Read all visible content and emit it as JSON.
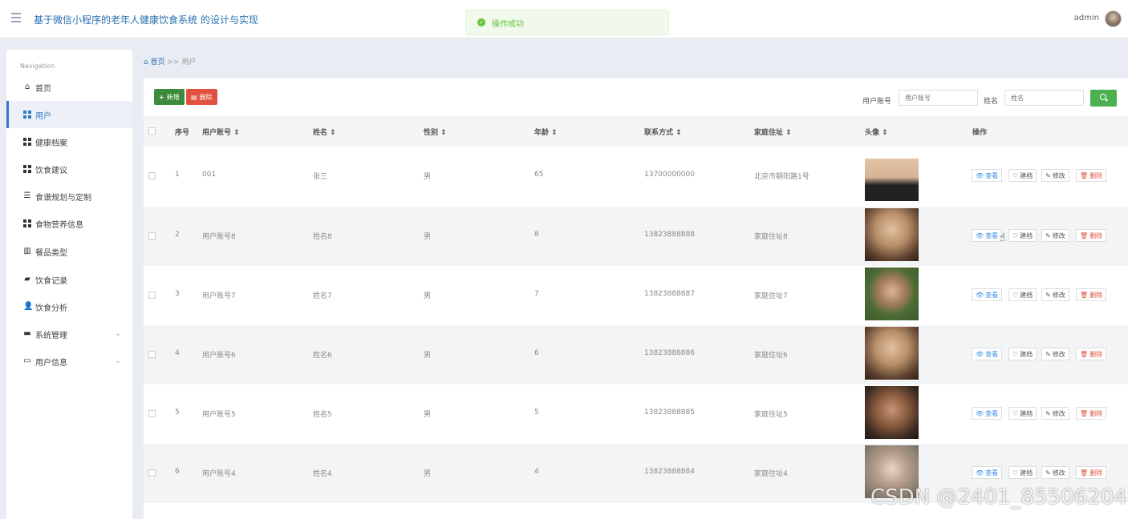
{
  "header": {
    "title": "基于微信小程序的老年人健康饮食系统 的设计与实现",
    "toast": "操作成功",
    "username": "admin"
  },
  "sidebar": {
    "title": "Navigation",
    "items": [
      {
        "label": "首页"
      },
      {
        "label": "用户"
      },
      {
        "label": "健康档案"
      },
      {
        "label": "饮食建议"
      },
      {
        "label": "食谱规划与定制"
      },
      {
        "label": "食物营养信息"
      },
      {
        "label": "餐品类型"
      },
      {
        "label": "饮食记录"
      },
      {
        "label": "饮食分析"
      },
      {
        "label": "系统管理"
      },
      {
        "label": "用户信息"
      }
    ]
  },
  "breadcrumb": {
    "home": "首页",
    "sep": ">>",
    "current": "用户"
  },
  "toolbar": {
    "add_label": "新增",
    "delete_label": "删除"
  },
  "search": {
    "account_label": "用户账号",
    "account_placeholder": "用户账号",
    "name_label": "姓名",
    "name_placeholder": "姓名"
  },
  "table": {
    "headers": [
      "序号",
      "用户账号",
      "姓名",
      "性别",
      "年龄",
      "联系方式",
      "家庭住址",
      "头像",
      "操作"
    ],
    "actions": {
      "view": "查看",
      "suggest": "建档",
      "edit": "修改",
      "remove": "删除"
    },
    "rows": [
      {
        "no": "1",
        "account": "001",
        "name": "张三",
        "gender": "男",
        "age": "65",
        "phone": "13700000000",
        "address": "北京市朝阳路1号"
      },
      {
        "no": "2",
        "account": "用户账号8",
        "name": "姓名8",
        "gender": "男",
        "age": "8",
        "phone": "13823888888",
        "address": "家庭住址8"
      },
      {
        "no": "3",
        "account": "用户账号7",
        "name": "姓名7",
        "gender": "男",
        "age": "7",
        "phone": "13823888887",
        "address": "家庭住址7"
      },
      {
        "no": "4",
        "account": "用户账号6",
        "name": "姓名6",
        "gender": "男",
        "age": "6",
        "phone": "13823888886",
        "address": "家庭住址6"
      },
      {
        "no": "5",
        "account": "用户账号5",
        "name": "姓名5",
        "gender": "男",
        "age": "5",
        "phone": "13823888885",
        "address": "家庭住址5"
      },
      {
        "no": "6",
        "account": "用户账号4",
        "name": "姓名4",
        "gender": "男",
        "age": "4",
        "phone": "13823888884",
        "address": "家庭住址4"
      }
    ]
  },
  "watermark": "CSDN @2401_85506204"
}
